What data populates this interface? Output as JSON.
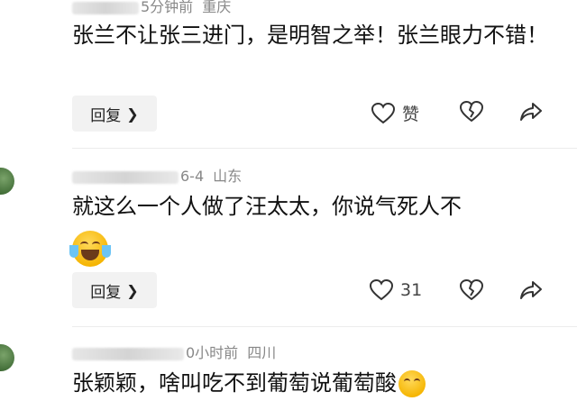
{
  "comments": [
    {
      "time": "5分钟前",
      "location": "重庆",
      "text": "张兰不让张三进门，是明智之举！张兰眼力不错！",
      "reply_label": "回复",
      "like_label": "赞"
    },
    {
      "time": "6-4",
      "location": "山东",
      "text": "就这么一个人做了汪太太，你说气死人不",
      "emoji": "laughing-with-tears-emoji",
      "reply_label": "回复",
      "like_count": "31"
    },
    {
      "time": "0小时前",
      "location": "四川",
      "text": "张颖颖，啥叫吃不到葡萄说葡萄酸"
    }
  ],
  "icons": {
    "like": "heart-icon",
    "dislike": "broken-heart-icon",
    "share": "share-arrow-icon"
  }
}
